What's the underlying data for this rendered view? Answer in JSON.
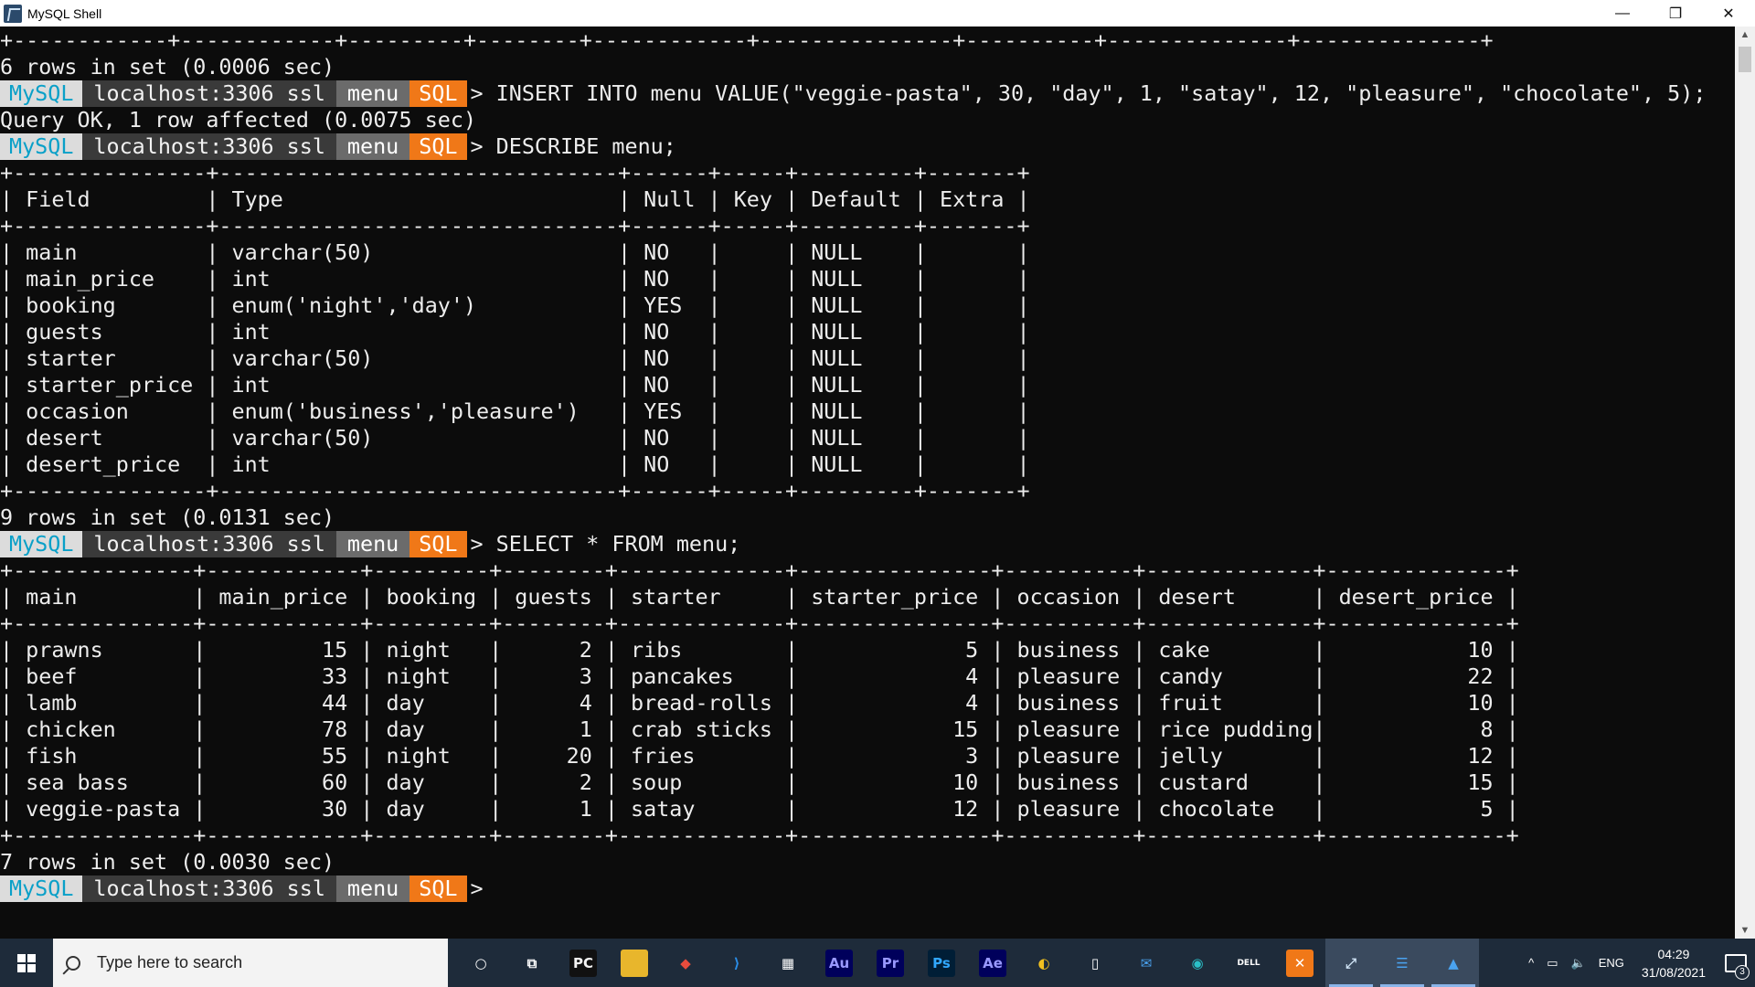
{
  "window": {
    "title": "MySQL Shell",
    "controls": {
      "minimize": "—",
      "restore": "❐",
      "close": "✕"
    }
  },
  "prompt": {
    "mysql": "MySQL",
    "host": "localhost:3306 ssl",
    "db": "menu",
    "mode": "SQL",
    "arrow": ">",
    "colors": {
      "mysql_fg": "#0aa0c8",
      "mode_bg": "#f07818"
    }
  },
  "terminal": {
    "lines": [
      {
        "type": "text",
        "text": "+------------+------------+---------+--------+------------+---------------+----------+--------------+--------------+"
      },
      {
        "type": "text",
        "text": "6 rows in set (0.0006 sec)"
      },
      {
        "type": "prompt",
        "cmd": " INSERT INTO menu VALUE(\"veggie-pasta\", 30, \"day\", 1, \"satay\", 12, \"pleasure\", \"chocolate\", 5);"
      },
      {
        "type": "text",
        "text": "Query OK, 1 row affected (0.0075 sec)"
      },
      {
        "type": "prompt",
        "cmd": " DESCRIBE menu;"
      },
      {
        "type": "text",
        "text": "+---------------+-------------------------------+------+-----+---------+-------+"
      },
      {
        "type": "text",
        "text": "| Field         | Type                          | Null | Key | Default | Extra |"
      },
      {
        "type": "text",
        "text": "+---------------+-------------------------------+------+-----+---------+-------+"
      },
      {
        "type": "text",
        "text": "| main          | varchar(50)                   | NO   |     | NULL    |       |"
      },
      {
        "type": "text",
        "text": "| main_price    | int                           | NO   |     | NULL    |       |"
      },
      {
        "type": "text",
        "text": "| booking       | enum('night','day')           | YES  |     | NULL    |       |"
      },
      {
        "type": "text",
        "text": "| guests        | int                           | NO   |     | NULL    |       |"
      },
      {
        "type": "text",
        "text": "| starter       | varchar(50)                   | NO   |     | NULL    |       |"
      },
      {
        "type": "text",
        "text": "| starter_price | int                           | NO   |     | NULL    |       |"
      },
      {
        "type": "text",
        "text": "| occasion      | enum('business','pleasure')   | YES  |     | NULL    |       |"
      },
      {
        "type": "text",
        "text": "| desert        | varchar(50)                   | NO   |     | NULL    |       |"
      },
      {
        "type": "text",
        "text": "| desert_price  | int                           | NO   |     | NULL    |       |"
      },
      {
        "type": "text",
        "text": "+---------------+-------------------------------+------+-----+---------+-------+"
      },
      {
        "type": "text",
        "text": "9 rows in set (0.0131 sec)"
      },
      {
        "type": "prompt",
        "cmd": " SELECT * FROM menu;"
      },
      {
        "type": "text",
        "text": "+--------------+------------+---------+--------+-------------+---------------+----------+-------------+--------------+"
      },
      {
        "type": "text",
        "text": "| main         | main_price | booking | guests | starter     | starter_price | occasion | desert      | desert_price |"
      },
      {
        "type": "text",
        "text": "+--------------+------------+---------+--------+-------------+---------------+----------+-------------+--------------+"
      },
      {
        "type": "text",
        "text": "| prawns       |         15 | night   |      2 | ribs        |             5 | business | cake        |           10 |"
      },
      {
        "type": "text",
        "text": "| beef         |         33 | night   |      3 | pancakes    |             4 | pleasure | candy       |           22 |"
      },
      {
        "type": "text",
        "text": "| lamb         |         44 | day     |      4 | bread-rolls |             4 | business | fruit       |           10 |"
      },
      {
        "type": "text",
        "text": "| chicken      |         78 | day     |      1 | crab sticks |            15 | pleasure | rice pudding|            8 |"
      },
      {
        "type": "text",
        "text": "| fish         |         55 | night   |     20 | fries       |             3 | pleasure | jelly       |           12 |"
      },
      {
        "type": "text",
        "text": "| sea bass     |         60 | day     |      2 | soup        |            10 | business | custard     |           15 |"
      },
      {
        "type": "text",
        "text": "| veggie-pasta |         30 | day     |      1 | satay       |            12 | pleasure | chocolate   |            5 |"
      },
      {
        "type": "text",
        "text": "+--------------+------------+---------+--------+-------------+---------------+----------+-------------+--------------+"
      },
      {
        "type": "text",
        "text": "7 rows in set (0.0030 sec)"
      },
      {
        "type": "prompt",
        "cmd": ""
      }
    ]
  },
  "scrollbar": {
    "up": "▲",
    "down": "▼"
  },
  "taskbar": {
    "search_placeholder": "Type here to search",
    "apps": [
      {
        "name": "cortana-icon",
        "label": "○",
        "bg": "transparent",
        "fg": "#ffffff"
      },
      {
        "name": "task-view-icon",
        "label": "⧉",
        "bg": "transparent",
        "fg": "#ffffff"
      },
      {
        "name": "pycharm-icon",
        "label": "PC",
        "bg": "#111111",
        "fg": "#f5f5f5"
      },
      {
        "name": "file-explorer-icon",
        "label": "▬",
        "bg": "#e8b62c",
        "fg": "#e8b62c"
      },
      {
        "name": "git-icon",
        "label": "◆",
        "bg": "transparent",
        "fg": "#e84c3d"
      },
      {
        "name": "vscode-icon",
        "label": "⟩",
        "bg": "transparent",
        "fg": "#2a8ee8"
      },
      {
        "name": "store-icon",
        "label": "▦",
        "bg": "transparent",
        "fg": "#ffffff"
      },
      {
        "name": "audition-icon",
        "label": "Au",
        "bg": "#00005b",
        "fg": "#9999ff"
      },
      {
        "name": "premiere-icon",
        "label": "Pr",
        "bg": "#00005b",
        "fg": "#9999ff"
      },
      {
        "name": "photoshop-icon",
        "label": "Ps",
        "bg": "#001e36",
        "fg": "#31a8ff"
      },
      {
        "name": "after-effects-icon",
        "label": "Ae",
        "bg": "#00005b",
        "fg": "#9999ff"
      },
      {
        "name": "chrome-canary-icon",
        "label": "◐",
        "bg": "transparent",
        "fg": "#f0c020"
      },
      {
        "name": "file-icon",
        "label": "▯",
        "bg": "transparent",
        "fg": "#ffffff"
      },
      {
        "name": "mail-icon",
        "label": "✉",
        "bg": "transparent",
        "fg": "#4aa3f0"
      },
      {
        "name": "edge-icon",
        "label": "◉",
        "bg": "transparent",
        "fg": "#2ac0c8"
      },
      {
        "name": "dell-icon",
        "label": "DELL",
        "bg": "transparent",
        "fg": "#ffffff"
      },
      {
        "name": "xampp-icon",
        "label": "✕",
        "bg": "#f07818",
        "fg": "#ffffff"
      },
      {
        "name": "mysql-shell-icon",
        "label": "⤢",
        "bg": "transparent",
        "fg": "#cfe3f5",
        "active": true
      },
      {
        "name": "notepad-icon",
        "label": "☰",
        "bg": "transparent",
        "fg": "#4aa3f0",
        "active": true
      },
      {
        "name": "photos-icon",
        "label": "▲",
        "bg": "transparent",
        "fg": "#4aa3f0",
        "active": true
      }
    ],
    "tray": {
      "chevron": "^",
      "battery": "▭",
      "volume": "🔈",
      "language": "ENG",
      "time": "04:29",
      "date": "31/08/2021",
      "notifications": "3"
    }
  }
}
